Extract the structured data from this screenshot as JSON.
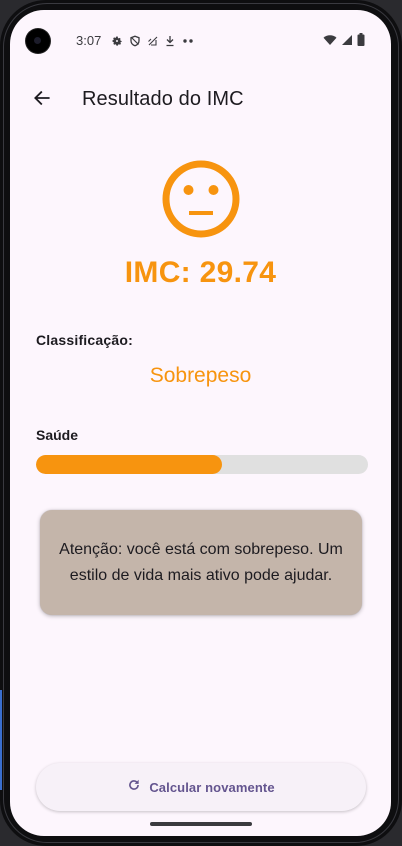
{
  "status_bar": {
    "time": "3:07",
    "left_icons": [
      "settings-icon",
      "shield-icon",
      "signal-off-icon",
      "download-icon",
      "more-dots-icon"
    ],
    "right_icons": [
      "wifi-icon",
      "cellular-icon",
      "battery-icon"
    ]
  },
  "app_bar": {
    "back_icon": "arrow-back-icon",
    "title": "Resultado do IMC"
  },
  "result": {
    "face_icon": "neutral-face-icon",
    "imc_text": "IMC: 29.74",
    "classification_label": "Classificação:",
    "classification_value": "Sobrepeso",
    "health_label": "Saúde",
    "health_progress_fraction": 0.56,
    "alert_message": "Atenção: você está com sobrepeso. Um estilo de vida mais ativo pode ajudar."
  },
  "actions": {
    "recalculate_icon": "refresh-icon",
    "recalculate_label": "Calcular novamente"
  },
  "colors": {
    "accent": "#f7940f",
    "screen_background": "#fdf6fd",
    "alert_background": "#c4b5aa",
    "progress_track": "#e0e0e0",
    "button_text": "#64558f"
  }
}
